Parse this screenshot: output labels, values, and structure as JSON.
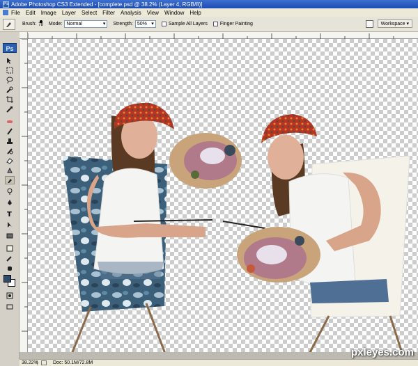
{
  "window": {
    "title": "Adobe Photoshop CS3 Extended - [complete.psd @ 38.2% (Layer 4, RGB/8)]"
  },
  "menu": {
    "items": [
      "File",
      "Edit",
      "Image",
      "Layer",
      "Select",
      "Filter",
      "Analysis",
      "View",
      "Window",
      "Help"
    ]
  },
  "options": {
    "brush_label": "Brush:",
    "brush_size": "78",
    "mode_label": "Mode:",
    "mode_value": "Normal",
    "strength_label": "Strength:",
    "strength_value": "50%",
    "sample_all_layers": "Sample All Layers",
    "finger_painting": "Finger Painting",
    "workspace_label": "Workspace ▾"
  },
  "toolbox": {
    "logo": "Ps",
    "foreground_color": "#2e4d6d",
    "background_color": "#ffffff",
    "tools": [
      "move-icon",
      "marquee-icon",
      "lasso-icon",
      "quick-selection-icon",
      "crop-icon",
      "eyedropper-icon",
      "healing-brush-icon",
      "brush-icon",
      "clone-stamp-icon",
      "history-brush-icon",
      "eraser-icon",
      "gradient-icon",
      "smudge-icon",
      "dodge-icon",
      "pen-icon",
      "type-icon",
      "path-selection-icon",
      "rectangle-icon",
      "notes-icon",
      "eyedropper-2-icon",
      "hand-icon",
      "zoom-icon"
    ],
    "active_tool": "smudge-icon"
  },
  "status": {
    "zoom": "38.22%",
    "doc_size": "Doc: 50.1M/72.8M"
  },
  "watermark": "pxleyes.com"
}
